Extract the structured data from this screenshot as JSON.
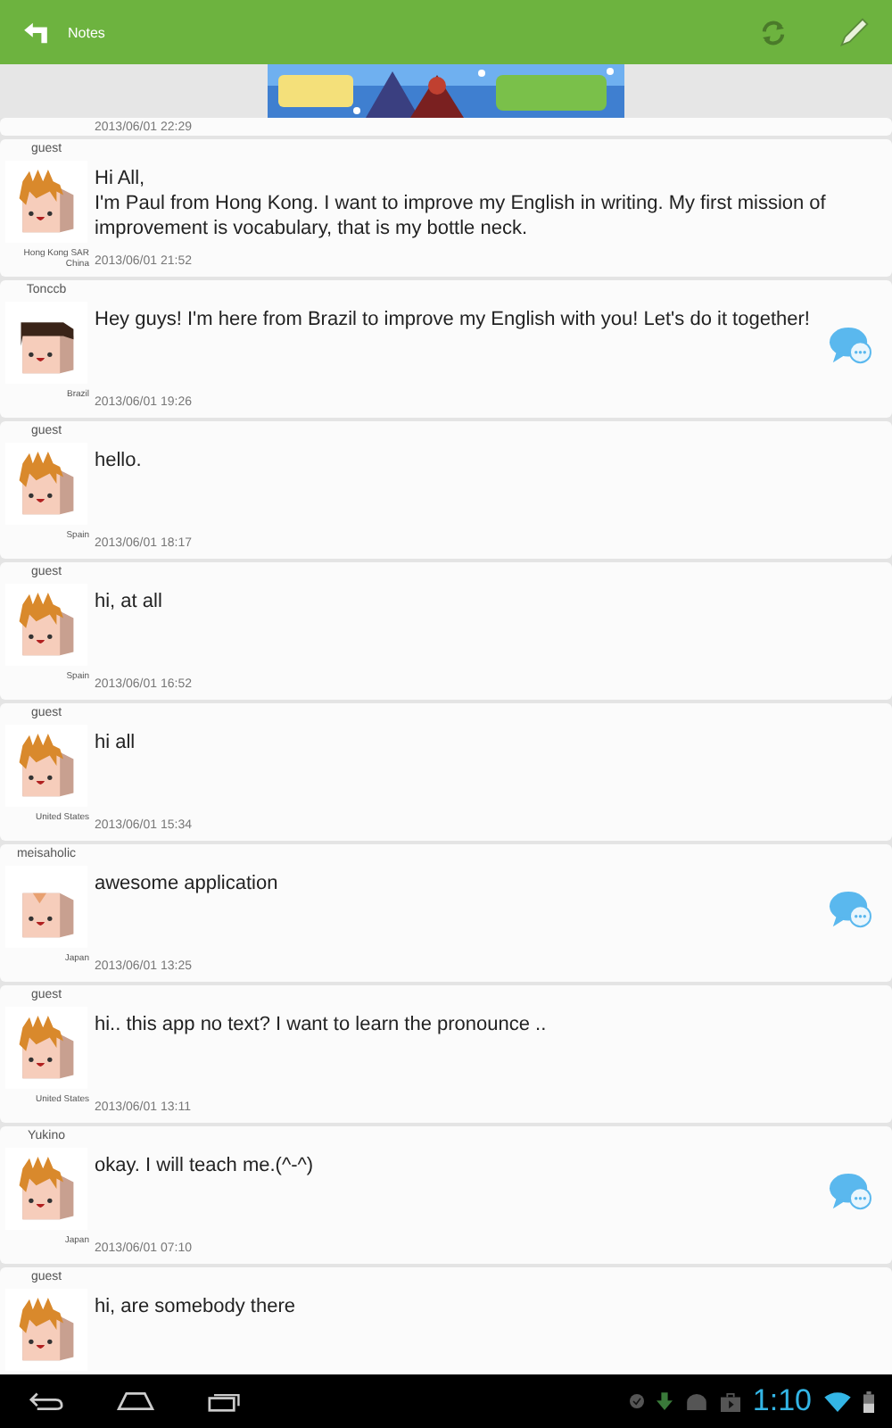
{
  "action_bar": {
    "title": "Notes"
  },
  "partial_post": {
    "date": "2013/06/01 22:29"
  },
  "posts": [
    {
      "name": "guest",
      "kind": "spiky",
      "country": "Hong Kong SAR China",
      "message": "Hi All,\nI'm Paul from Hong Kong. I want to improve my English in writing. My first mission of improvement is vocabulary, that is my bottle neck.",
      "date": "2013/06/01 21:52",
      "replied": false
    },
    {
      "name": "Tonccb",
      "kind": "flat",
      "country": "Brazil",
      "message": "Hey guys! I'm here from Brazil to improve my English with you! Let's do it together!",
      "date": "2013/06/01 19:26",
      "replied": true
    },
    {
      "name": "guest",
      "kind": "spiky",
      "country": "Spain",
      "message": "hello.",
      "date": "2013/06/01 18:17",
      "replied": false
    },
    {
      "name": "guest",
      "kind": "spiky",
      "country": "Spain",
      "message": "hi, at all",
      "date": "2013/06/01 16:52",
      "replied": false
    },
    {
      "name": "guest",
      "kind": "spiky",
      "country": "United States",
      "message": "hi all",
      "date": "2013/06/01 15:34",
      "replied": false
    },
    {
      "name": "meisaholic",
      "kind": "plain",
      "country": "Japan",
      "message": "awesome application",
      "date": "2013/06/01 13:25",
      "replied": true
    },
    {
      "name": "guest",
      "kind": "spiky",
      "country": "United States",
      "message": "hi.. this app no text? I want to learn the pronounce ..",
      "date": "2013/06/01 13:11",
      "replied": false
    },
    {
      "name": "Yukino",
      "kind": "spiky",
      "country": "Japan",
      "message": "okay. I will teach me.(^-^)",
      "date": "2013/06/01 07:10",
      "replied": true
    },
    {
      "name": "guest",
      "kind": "spiky",
      "message": "hi, are somebody there"
    }
  ],
  "status_bar": {
    "time": "1:10"
  }
}
